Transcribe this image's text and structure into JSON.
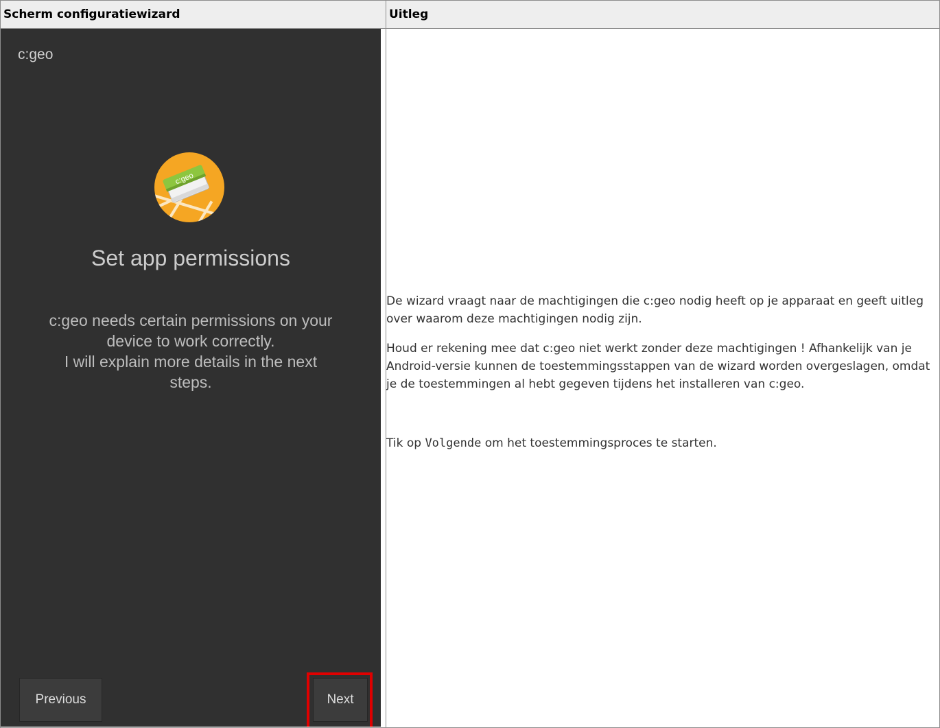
{
  "table": {
    "col1_header": "Scherm configuratiewizard",
    "col2_header": "Uitleg"
  },
  "phone": {
    "app_name": "c:geo",
    "logo_text": "c:geo",
    "title": "Set app permissions",
    "body_lines": [
      "c:geo needs certain permissions on your",
      "device to work correctly.",
      "I will explain more details in the next",
      "steps."
    ],
    "previous_label": "Previous",
    "next_label": "Next"
  },
  "explanation": {
    "p1": "De wizard vraagt naar de machtigingen die c:geo nodig heeft op je apparaat en geeft uitleg over waarom deze machtigingen nodig zijn.",
    "p2": "Houd er rekening mee dat c:geo niet werkt zonder deze machtigingen ! Afhankelijk van je Android-versie kunnen de toestemmingsstappen van de wizard worden overgeslagen, omdat je de toestemmingen al hebt gegeven tijdens het installeren van c:geo.",
    "tip_prefix": "Tik op ",
    "tip_code": "Volgende",
    "tip_suffix": " om het toestemmingsproces te starten."
  },
  "colors": {
    "highlight": "#e00000",
    "phone_bg": "#303030",
    "logo_orange": "#f5a623",
    "logo_green": "#8dc63f"
  }
}
